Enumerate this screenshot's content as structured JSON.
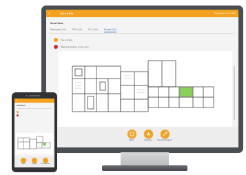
{
  "colors": {
    "accent": "#f2a21e",
    "alert": "#c8323a",
    "link": "#2a6fb5",
    "bezel": "#4a4d52",
    "room_highlight": "#8bd05a"
  },
  "desktop": {
    "topbar": {
      "brand": "GOLDEN",
      "right_text": "Thursday 16 June 2023"
    },
    "page_title": "Send floor",
    "tabs": [
      {
        "label": "Basement (-1/0)",
        "active": false
      },
      {
        "label": "RDC (1/2)",
        "active": false
      },
      {
        "label": "R+1 (1/2)",
        "active": false
      },
      {
        "label": "Terrace (1/1)",
        "active": true
      }
    ],
    "status": [
      {
        "label": "You are here",
        "icon": "location-icon",
        "color": "#f2a21e"
      },
      {
        "label": "Shared at location of this room",
        "icon": "alert-icon",
        "color": "#c8323a"
      }
    ],
    "actions": [
      {
        "label": "Floors",
        "icon": "floors-icon"
      },
      {
        "label": "Navigate",
        "icon": "navigate-icon"
      },
      {
        "label": "Services Request",
        "icon": "request-icon"
      }
    ]
  },
  "phone": {
    "page_title": "Send floor",
    "actions": [
      {
        "label": "Floors",
        "icon": "floors-icon"
      },
      {
        "label": "Navigate",
        "icon": "navigate-icon"
      },
      {
        "label": "Services Request",
        "icon": "request-icon"
      }
    ]
  }
}
